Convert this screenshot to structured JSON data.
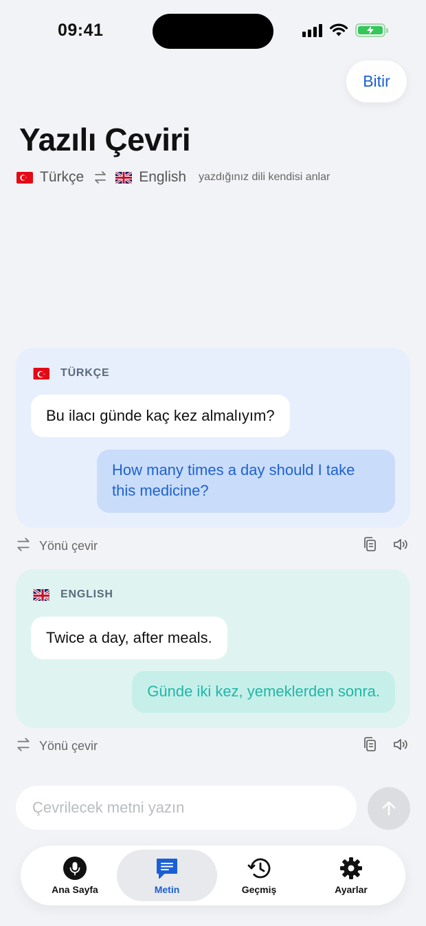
{
  "status_bar": {
    "time": "09:41"
  },
  "header": {
    "done_label": "Bitir",
    "title": "Yazılı Çeviri",
    "source_lang": "Türkçe",
    "target_lang": "English",
    "hint": "yazdığınız dili kendisi anlar"
  },
  "conversation": [
    {
      "lang_label": "TÜRKÇE",
      "flag": "tr-flag",
      "original": "Bu ilacı günde kaç kez almalıyım?",
      "translation": "How many times a day should I take this medicine?",
      "flip_label": "Yönü çevir"
    },
    {
      "lang_label": "ENGLISH",
      "flag": "uk-flag",
      "original": "Twice a day, after meals.",
      "translation": "Günde iki kez, yemeklerden sonra.",
      "flip_label": "Yönü çevir"
    }
  ],
  "composer": {
    "placeholder": "Çevrilecek metni yazın",
    "value": ""
  },
  "tabs": [
    {
      "label": "Ana Sayfa",
      "icon": "mic-icon",
      "active": false
    },
    {
      "label": "Metin",
      "icon": "chat-icon",
      "active": true
    },
    {
      "label": "Geçmiş",
      "icon": "history-icon",
      "active": false
    },
    {
      "label": "Ayarlar",
      "icon": "gear-icon",
      "active": false
    }
  ],
  "colors": {
    "accent": "#1a5fd6",
    "turkish_card": "#e7effd",
    "english_card": "#dff4f1",
    "teal_text": "#1fb7a6"
  }
}
